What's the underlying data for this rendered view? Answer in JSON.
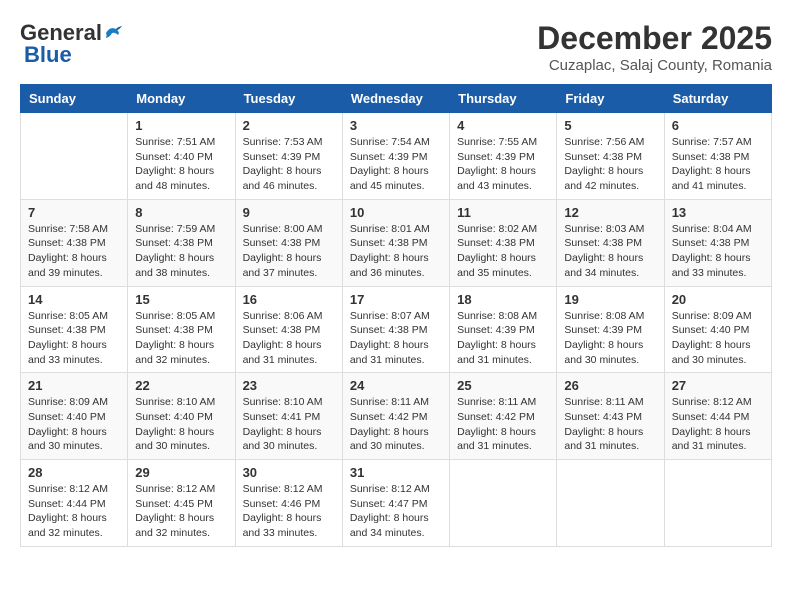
{
  "header": {
    "logo_general": "General",
    "logo_blue": "Blue",
    "month_title": "December 2025",
    "location": "Cuzaplac, Salaj County, Romania"
  },
  "weekdays": [
    "Sunday",
    "Monday",
    "Tuesday",
    "Wednesday",
    "Thursday",
    "Friday",
    "Saturday"
  ],
  "weeks": [
    [
      {
        "day": "",
        "info": ""
      },
      {
        "day": "1",
        "info": "Sunrise: 7:51 AM\nSunset: 4:40 PM\nDaylight: 8 hours\nand 48 minutes."
      },
      {
        "day": "2",
        "info": "Sunrise: 7:53 AM\nSunset: 4:39 PM\nDaylight: 8 hours\nand 46 minutes."
      },
      {
        "day": "3",
        "info": "Sunrise: 7:54 AM\nSunset: 4:39 PM\nDaylight: 8 hours\nand 45 minutes."
      },
      {
        "day": "4",
        "info": "Sunrise: 7:55 AM\nSunset: 4:39 PM\nDaylight: 8 hours\nand 43 minutes."
      },
      {
        "day": "5",
        "info": "Sunrise: 7:56 AM\nSunset: 4:38 PM\nDaylight: 8 hours\nand 42 minutes."
      },
      {
        "day": "6",
        "info": "Sunrise: 7:57 AM\nSunset: 4:38 PM\nDaylight: 8 hours\nand 41 minutes."
      }
    ],
    [
      {
        "day": "7",
        "info": "Sunrise: 7:58 AM\nSunset: 4:38 PM\nDaylight: 8 hours\nand 39 minutes."
      },
      {
        "day": "8",
        "info": "Sunrise: 7:59 AM\nSunset: 4:38 PM\nDaylight: 8 hours\nand 38 minutes."
      },
      {
        "day": "9",
        "info": "Sunrise: 8:00 AM\nSunset: 4:38 PM\nDaylight: 8 hours\nand 37 minutes."
      },
      {
        "day": "10",
        "info": "Sunrise: 8:01 AM\nSunset: 4:38 PM\nDaylight: 8 hours\nand 36 minutes."
      },
      {
        "day": "11",
        "info": "Sunrise: 8:02 AM\nSunset: 4:38 PM\nDaylight: 8 hours\nand 35 minutes."
      },
      {
        "day": "12",
        "info": "Sunrise: 8:03 AM\nSunset: 4:38 PM\nDaylight: 8 hours\nand 34 minutes."
      },
      {
        "day": "13",
        "info": "Sunrise: 8:04 AM\nSunset: 4:38 PM\nDaylight: 8 hours\nand 33 minutes."
      }
    ],
    [
      {
        "day": "14",
        "info": "Sunrise: 8:05 AM\nSunset: 4:38 PM\nDaylight: 8 hours\nand 33 minutes."
      },
      {
        "day": "15",
        "info": "Sunrise: 8:05 AM\nSunset: 4:38 PM\nDaylight: 8 hours\nand 32 minutes."
      },
      {
        "day": "16",
        "info": "Sunrise: 8:06 AM\nSunset: 4:38 PM\nDaylight: 8 hours\nand 31 minutes."
      },
      {
        "day": "17",
        "info": "Sunrise: 8:07 AM\nSunset: 4:38 PM\nDaylight: 8 hours\nand 31 minutes."
      },
      {
        "day": "18",
        "info": "Sunrise: 8:08 AM\nSunset: 4:39 PM\nDaylight: 8 hours\nand 31 minutes."
      },
      {
        "day": "19",
        "info": "Sunrise: 8:08 AM\nSunset: 4:39 PM\nDaylight: 8 hours\nand 30 minutes."
      },
      {
        "day": "20",
        "info": "Sunrise: 8:09 AM\nSunset: 4:40 PM\nDaylight: 8 hours\nand 30 minutes."
      }
    ],
    [
      {
        "day": "21",
        "info": "Sunrise: 8:09 AM\nSunset: 4:40 PM\nDaylight: 8 hours\nand 30 minutes."
      },
      {
        "day": "22",
        "info": "Sunrise: 8:10 AM\nSunset: 4:40 PM\nDaylight: 8 hours\nand 30 minutes."
      },
      {
        "day": "23",
        "info": "Sunrise: 8:10 AM\nSunset: 4:41 PM\nDaylight: 8 hours\nand 30 minutes."
      },
      {
        "day": "24",
        "info": "Sunrise: 8:11 AM\nSunset: 4:42 PM\nDaylight: 8 hours\nand 30 minutes."
      },
      {
        "day": "25",
        "info": "Sunrise: 8:11 AM\nSunset: 4:42 PM\nDaylight: 8 hours\nand 31 minutes."
      },
      {
        "day": "26",
        "info": "Sunrise: 8:11 AM\nSunset: 4:43 PM\nDaylight: 8 hours\nand 31 minutes."
      },
      {
        "day": "27",
        "info": "Sunrise: 8:12 AM\nSunset: 4:44 PM\nDaylight: 8 hours\nand 31 minutes."
      }
    ],
    [
      {
        "day": "28",
        "info": "Sunrise: 8:12 AM\nSunset: 4:44 PM\nDaylight: 8 hours\nand 32 minutes."
      },
      {
        "day": "29",
        "info": "Sunrise: 8:12 AM\nSunset: 4:45 PM\nDaylight: 8 hours\nand 32 minutes."
      },
      {
        "day": "30",
        "info": "Sunrise: 8:12 AM\nSunset: 4:46 PM\nDaylight: 8 hours\nand 33 minutes."
      },
      {
        "day": "31",
        "info": "Sunrise: 8:12 AM\nSunset: 4:47 PM\nDaylight: 8 hours\nand 34 minutes."
      },
      {
        "day": "",
        "info": ""
      },
      {
        "day": "",
        "info": ""
      },
      {
        "day": "",
        "info": ""
      }
    ]
  ]
}
